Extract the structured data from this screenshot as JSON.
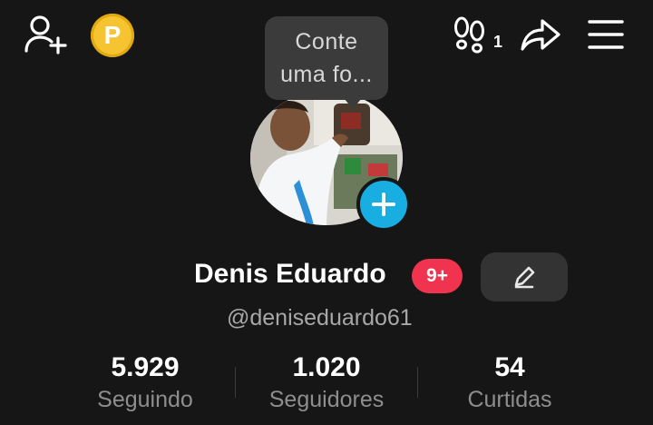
{
  "header": {
    "footprint_count": "1",
    "coin_label": "P",
    "icons": [
      "add-friend-icon",
      "coin-icon",
      "footprints-icon",
      "share-icon",
      "menu-icon"
    ]
  },
  "tooltip": {
    "line1": "Conte",
    "line2": "uma fo..."
  },
  "profile": {
    "display_name": "Denis Eduardo",
    "badge": "9+",
    "username": "@deniseduardo61"
  },
  "stats": [
    {
      "value": "5.929",
      "label": "Seguindo"
    },
    {
      "value": "1.020",
      "label": "Seguidores"
    },
    {
      "value": "54",
      "label": "Curtidas"
    }
  ],
  "colors": {
    "background": "#161616",
    "accent_add": "#19aee1",
    "badge": "#f0344f",
    "coin": "#f7c431"
  }
}
